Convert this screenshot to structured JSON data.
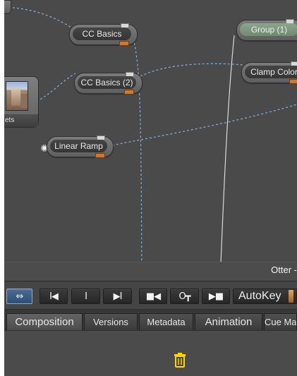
{
  "schematic": {
    "nodes": {
      "cc_basics": {
        "label": "CC Basics"
      },
      "cc_basics_2": {
        "label": "CC Basics (2)"
      },
      "linear_ramp": {
        "label": "Linear Ramp",
        "icon": "gear-icon"
      },
      "group_1": {
        "label": "Group (1)"
      },
      "clamp_color": {
        "label": "Clamp Color"
      },
      "asset_thumbnail": {
        "label": "ets",
        "icon": "image-thumbnail"
      }
    }
  },
  "status_bar": {
    "text": "Otter -"
  },
  "toolbar": {
    "buttons": [
      {
        "name": "link-toggle",
        "label": "⇔",
        "icon": "bidirectional-arrow-icon",
        "active": true
      },
      {
        "name": "go-to-start",
        "label": "I◀",
        "icon": "go-to-start-icon"
      },
      {
        "name": "set-marker",
        "label": "I",
        "icon": "set-marker-icon"
      },
      {
        "name": "go-to-end",
        "label": "▶I",
        "icon": "go-to-end-icon"
      },
      {
        "name": "previous-key",
        "label": "■◀",
        "icon": "previous-key-icon"
      },
      {
        "name": "key",
        "label": "O┳",
        "icon": "key-icon"
      },
      {
        "name": "next-key",
        "label": "▶■",
        "icon": "next-key-icon"
      }
    ],
    "autokey_label": "AutoKey"
  },
  "tabs": [
    {
      "label": "Composition",
      "active": true
    },
    {
      "label": "Versions",
      "active": false
    },
    {
      "label": "Metadata",
      "active": false
    },
    {
      "label": "Animation",
      "active": false
    },
    {
      "label": "Cue Ma",
      "active": false
    }
  ],
  "panel": {
    "trash_icon": "trash-icon"
  },
  "colors": {
    "background": "#4a4a4a",
    "wire_blue": "#7fb2df",
    "accent_orange": "#cb7a2e",
    "active_button": "#3e5f87",
    "group_green": "#7f997f",
    "trash_yellow": "#ffd500"
  }
}
